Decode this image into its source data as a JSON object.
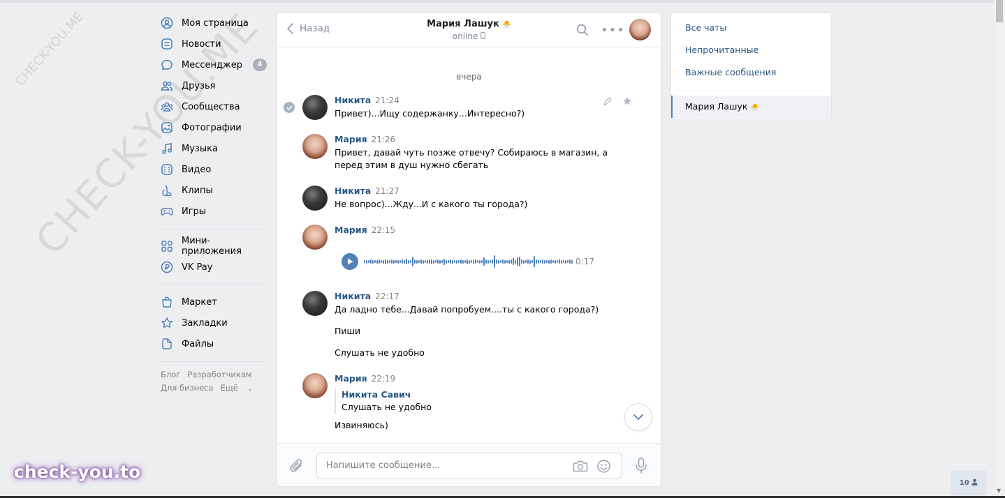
{
  "watermark": {
    "big": "CHECK-YOU.ME",
    "small": "CHECK-YOU.ME",
    "bottom": "check-you.to"
  },
  "nav": {
    "items": [
      {
        "label": "Моя страница",
        "icon": "profile-icon"
      },
      {
        "label": "Новости",
        "icon": "news-icon"
      },
      {
        "label": "Мессенджер",
        "icon": "messenger-icon",
        "badge": "4"
      },
      {
        "label": "Друзья",
        "icon": "friends-icon"
      },
      {
        "label": "Сообщества",
        "icon": "communities-icon"
      },
      {
        "label": "Фотографии",
        "icon": "photos-icon"
      },
      {
        "label": "Музыка",
        "icon": "music-icon"
      },
      {
        "label": "Видео",
        "icon": "video-icon"
      },
      {
        "label": "Клипы",
        "icon": "clips-icon"
      },
      {
        "label": "Игры",
        "icon": "games-icon"
      }
    ],
    "items2": [
      {
        "label": "Мини-приложения",
        "icon": "mini-apps-icon"
      },
      {
        "label": "VK Pay",
        "icon": "vkpay-icon"
      }
    ],
    "items3": [
      {
        "label": "Маркет",
        "icon": "market-icon"
      },
      {
        "label": "Закладки",
        "icon": "bookmarks-icon"
      },
      {
        "label": "Файлы",
        "icon": "files-icon"
      }
    ],
    "footer": {
      "blog": "Блог",
      "developers": "Разработчикам",
      "business": "Для бизнеса",
      "more": "Ещё"
    }
  },
  "chat": {
    "back_label": "Назад",
    "peer_name": "Мария Лашук",
    "peer_status": "online",
    "date_divider": "вчера",
    "messages": [
      {
        "author": "Никита",
        "time": "21:24",
        "lines": [
          "Привет)...Ищу содержанку...Интересно?)"
        ]
      },
      {
        "author": "Мария",
        "time": "21:26",
        "lines": [
          "Привет, давай чуть позже отвечу? Собираюсь в магазин, а",
          "перед этим в душ нужно сбегать"
        ]
      },
      {
        "author": "Никита",
        "time": "21:27",
        "lines": [
          "Не вопрос)...Жду...И с какого ты города?)"
        ]
      },
      {
        "author": "Мария",
        "time": "22:15",
        "voice_duration": "0:17"
      },
      {
        "author": "Никита",
        "time": "22:17",
        "lines": [
          "Да ладно тебе...Давай попробуем....ты с какого города?)",
          "Пиши",
          "Слушать не удобно"
        ]
      },
      {
        "author": "Мария",
        "time": "22:19",
        "reply_author": "Никита Савич",
        "reply_text": "Слушать не удобно",
        "lines": [
          "Извиняюсь)"
        ]
      }
    ],
    "input_placeholder": "Напишите сообщение..."
  },
  "right_panel": {
    "all_chats": "Все чаты",
    "unread": "Непрочитанные",
    "important": "Важные сообщения",
    "selected_chat": "Мария Лашук"
  },
  "online_count": "10",
  "colors": {
    "accent": "#5181b8",
    "link": "#2a5885",
    "background": "#edeef0"
  }
}
